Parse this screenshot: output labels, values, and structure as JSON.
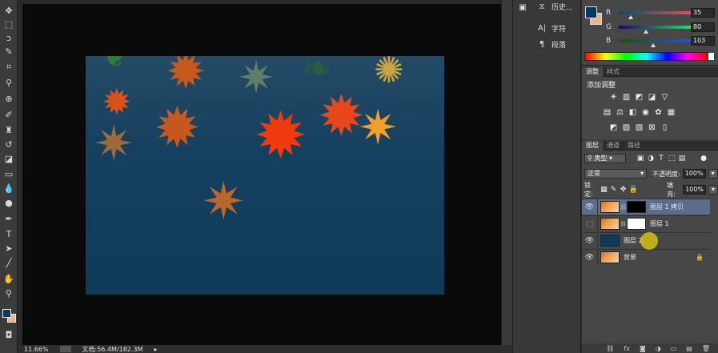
{
  "toolbar": {
    "tools": [
      "move-tool-icon",
      "marquee-tool-icon",
      "lasso-tool-icon",
      "quick-select-tool-icon",
      "crop-tool-icon",
      "eyedropper-tool-icon",
      "healing-brush-tool-icon",
      "brush-tool-icon",
      "clone-stamp-tool-icon",
      "history-brush-tool-icon",
      "eraser-tool-icon",
      "gradient-tool-icon",
      "blur-tool-icon",
      "dodge-tool-icon",
      "pen-tool-icon",
      "type-tool-icon",
      "path-select-tool-icon",
      "line-tool-icon",
      "hand-tool-icon",
      "zoom-tool-icon"
    ]
  },
  "status": {
    "zoom": "11.66%",
    "doc_info": "文档:56.4M/182.3M"
  },
  "mid_panel": {
    "history_label": "历史...",
    "character_label": "字符",
    "paragraph_label": "段落"
  },
  "color_panel": {
    "r_label": "R",
    "r_value": "35",
    "g_label": "G",
    "g_value": "80",
    "b_label": "B",
    "b_value": "103",
    "fg_color": "#0d3a5c",
    "bg_color": "#e8b690"
  },
  "adjust_panel": {
    "tabs": [
      "调整",
      "样式"
    ],
    "title": "添加调整"
  },
  "layers_panel": {
    "tabs": [
      "图层",
      "通道",
      "路径"
    ],
    "kind_filter": "类型",
    "blend_mode": "正常",
    "opacity_label": "不透明度:",
    "opacity_value": "100%",
    "lock_label": "锁定:",
    "fill_label": "填充:",
    "fill_value": "100%",
    "layers": [
      {
        "name": "图层 1 拷贝"
      },
      {
        "name": "图层 1"
      },
      {
        "name": "图层 2"
      },
      {
        "name": "背景"
      }
    ]
  }
}
